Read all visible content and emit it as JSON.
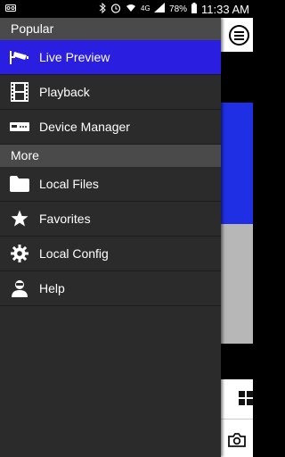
{
  "status_bar": {
    "time": "11:33 AM",
    "battery": "78%",
    "icons": [
      "voicemail-icon",
      "bluetooth-icon",
      "alarm-icon",
      "wifi-icon",
      "4g-icon",
      "signal-icon",
      "battery-icon"
    ]
  },
  "drawer": {
    "sections": [
      {
        "title": "Popular",
        "items": [
          {
            "label": "Live Preview",
            "icon": "cctv-camera-icon",
            "active": true
          },
          {
            "label": "Playback",
            "icon": "film-strip-icon",
            "active": false
          },
          {
            "label": "Device Manager",
            "icon": "dvr-device-icon",
            "active": false
          }
        ]
      },
      {
        "title": "More",
        "items": [
          {
            "label": "Local Files",
            "icon": "folder-icon",
            "active": false
          },
          {
            "label": "Favorites",
            "icon": "star-icon",
            "active": false
          },
          {
            "label": "Local Config",
            "icon": "gear-icon",
            "active": false
          },
          {
            "label": "Help",
            "icon": "person-icon",
            "active": false
          }
        ]
      }
    ]
  },
  "colors": {
    "drawer_bg": "#2b2b2b",
    "section_bg": "#4a4a4a",
    "active_item": "#2a1ee0",
    "background_blue": "#1f2fe3"
  }
}
